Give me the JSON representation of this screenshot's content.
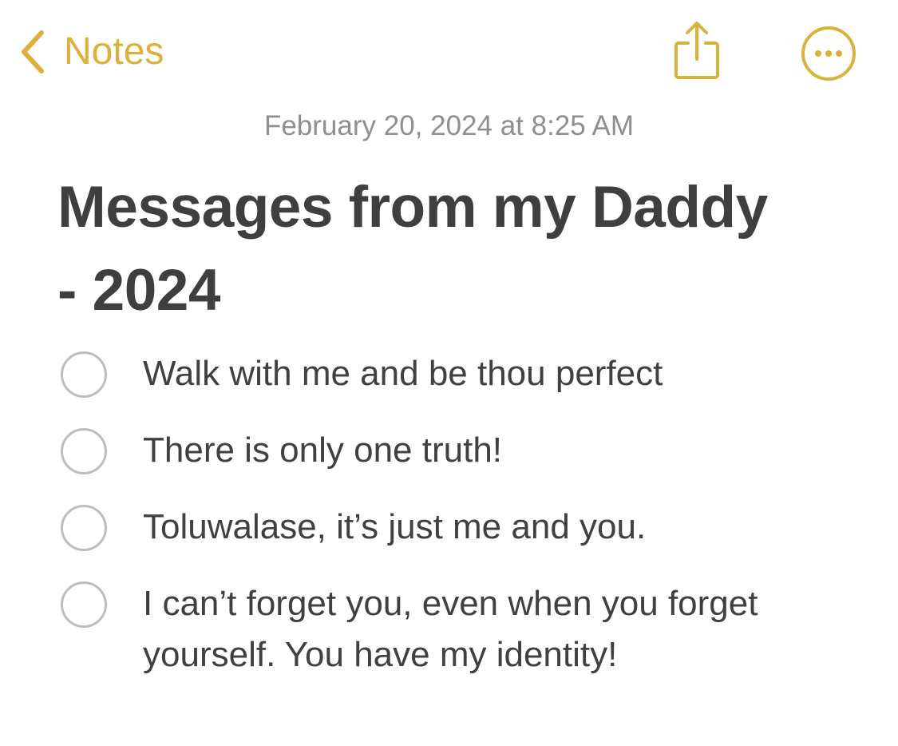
{
  "nav": {
    "back_label": "Notes",
    "accent_color": "#d9b13b",
    "back_icon": "chevron-left-icon",
    "share_icon": "share-icon",
    "more_icon": "ellipsis-circle-icon"
  },
  "note": {
    "date": "February 20, 2024 at 8:25 AM",
    "title_line1": "Messages from my Daddy",
    "title_line2": "- 2024",
    "checklist": [
      {
        "text": "Walk with me and be thou perfect",
        "checked": false
      },
      {
        "text": "There is only one truth!",
        "checked": false
      },
      {
        "text": "Toluwalase, it’s just me and you.",
        "checked": false
      },
      {
        "text": "I can’t forget you, even when you forget yourself. You have my identity!",
        "checked": false
      }
    ]
  }
}
